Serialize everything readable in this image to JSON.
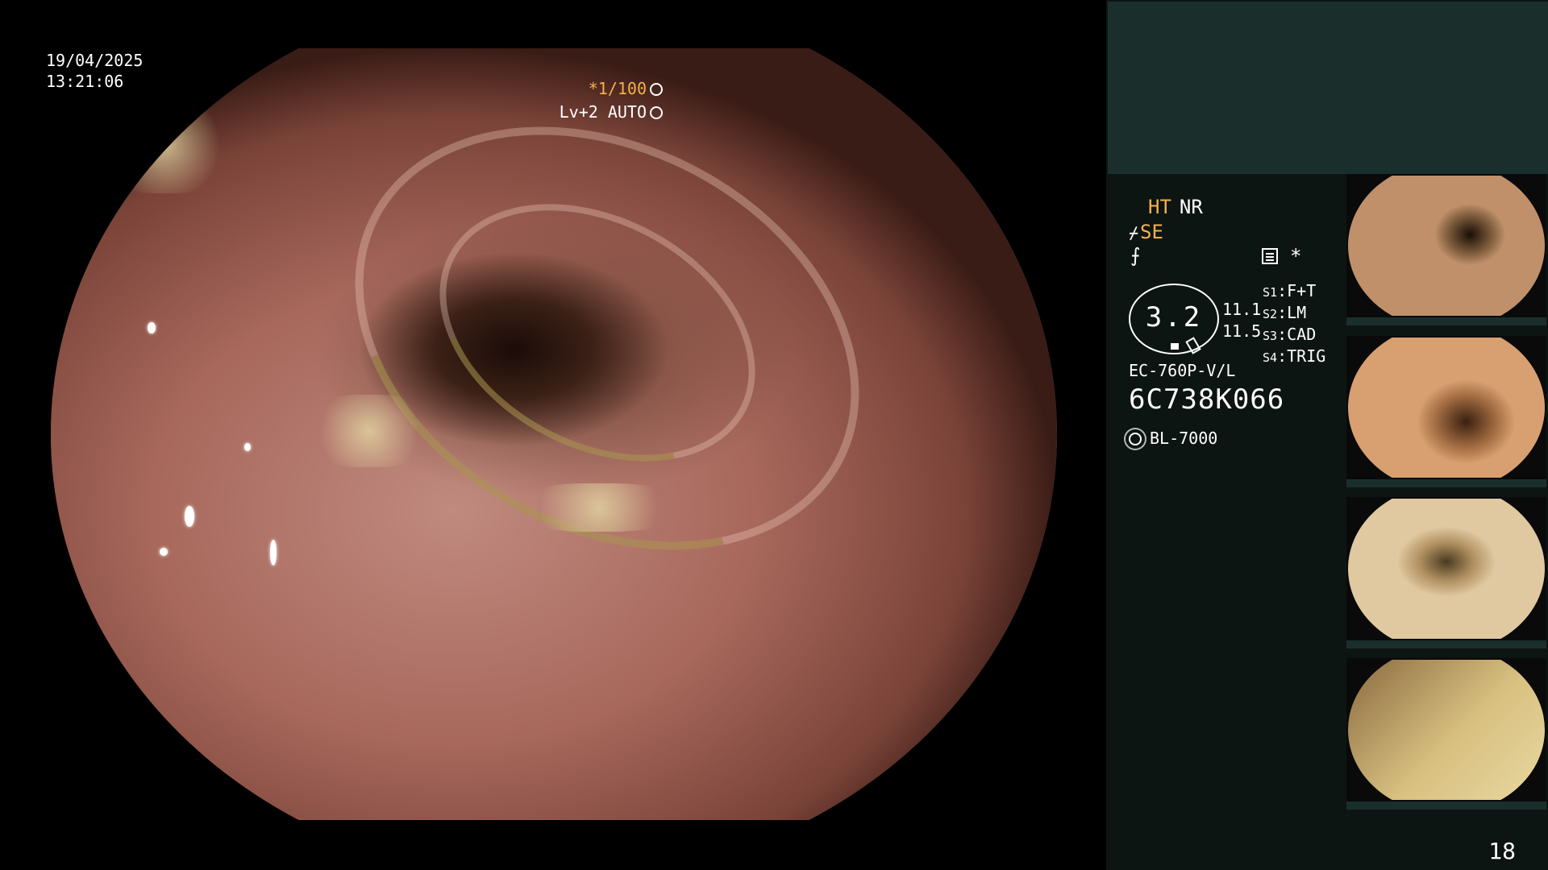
{
  "overlay": {
    "date": "19/04/2025",
    "time": "13:21:06",
    "shutter": "*1/100",
    "level": "Lv+2 AUTO"
  },
  "panel": {
    "ht": "HT",
    "nr": "NR",
    "se": "SE",
    "star": "*",
    "gauge_value": "3.2",
    "gauge_r1": "11.1",
    "gauge_r2": "11.5",
    "switches": [
      {
        "key": "S1",
        "value": "F+T"
      },
      {
        "key": "S2",
        "value": "LM"
      },
      {
        "key": "S3",
        "value": "CAD"
      },
      {
        "key": "S4",
        "value": "TRIG"
      }
    ],
    "scope_model": "EC-760P-V/L",
    "scope_serial": "6C738K066",
    "light_source": "BL-7000"
  },
  "page_number": "18",
  "icons": {
    "shutter_icon": "aperture-icon",
    "level_icon": "iris-icon",
    "light_icon": "sun-icon"
  },
  "colors": {
    "accent": "#f2b24a",
    "panel_top": "#1a2f2c",
    "panel_bg": "#0d1513"
  }
}
